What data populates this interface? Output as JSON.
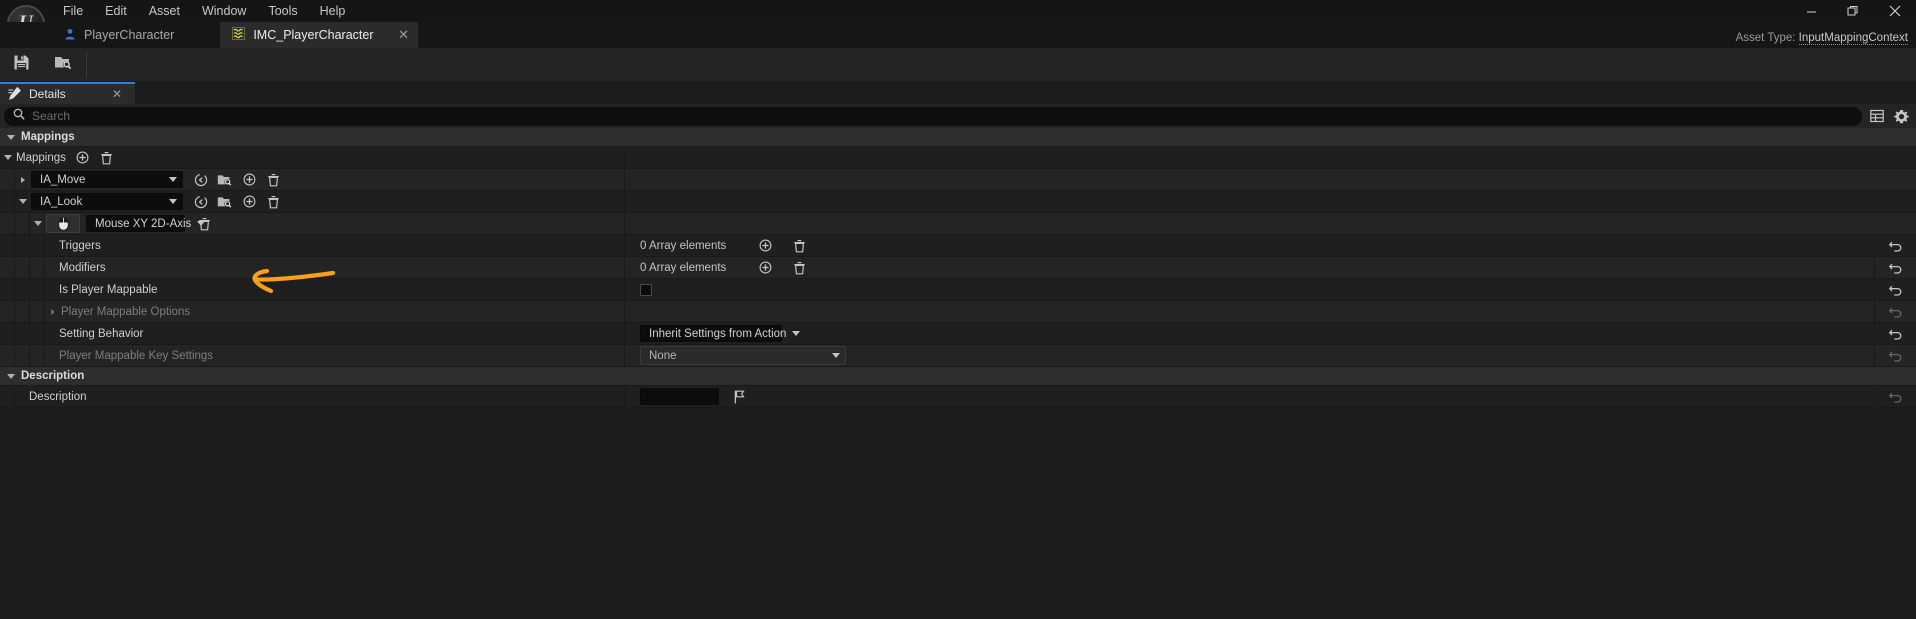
{
  "window": {
    "menus": [
      "File",
      "Edit",
      "Asset",
      "Window",
      "Tools",
      "Help"
    ],
    "logo_glyph": "U",
    "minimize": "—",
    "restore": "❐",
    "close": "✕"
  },
  "tabs": {
    "inactive": {
      "label": "PlayerCharacter",
      "icon": "blueprint-character-icon"
    },
    "active": {
      "label": "IMC_PlayerCharacter",
      "icon": "input-mapping-context-icon",
      "close": "✕"
    },
    "asset_type_label": "Asset Type:",
    "asset_type_value": "InputMappingContext"
  },
  "toolbar": {
    "save_tooltip": "Save",
    "browse_tooltip": "Browse"
  },
  "panel": {
    "tab_label": "Details",
    "tab_close": "✕",
    "accent_color": "#2b7fd4"
  },
  "search": {
    "placeholder": "Search"
  },
  "categories": {
    "mappings": "Mappings",
    "description": "Description"
  },
  "rows": {
    "mappings_array": {
      "label": "Mappings"
    },
    "ia_move": {
      "value": "IA_Move"
    },
    "ia_look": {
      "value": "IA_Look"
    },
    "key_binding": {
      "value": "Mouse XY 2D-Axis"
    },
    "triggers": {
      "label": "Triggers",
      "value": "0 Array elements"
    },
    "modifiers": {
      "label": "Modifiers",
      "value": "0 Array elements"
    },
    "is_player_mappable": {
      "label": "Is Player Mappable",
      "checked": false
    },
    "player_mappable_options": {
      "label": "Player Mappable Options"
    },
    "setting_behavior": {
      "label": "Setting Behavior",
      "value": "Inherit Settings from Action"
    },
    "player_mappable_key_settings": {
      "label": "Player Mappable Key Settings",
      "value": "None"
    },
    "description": {
      "label": "Description",
      "value": ""
    }
  },
  "annotation": {
    "type": "hand-drawn-arrow",
    "direction": "left",
    "color": "#f5a11a"
  }
}
